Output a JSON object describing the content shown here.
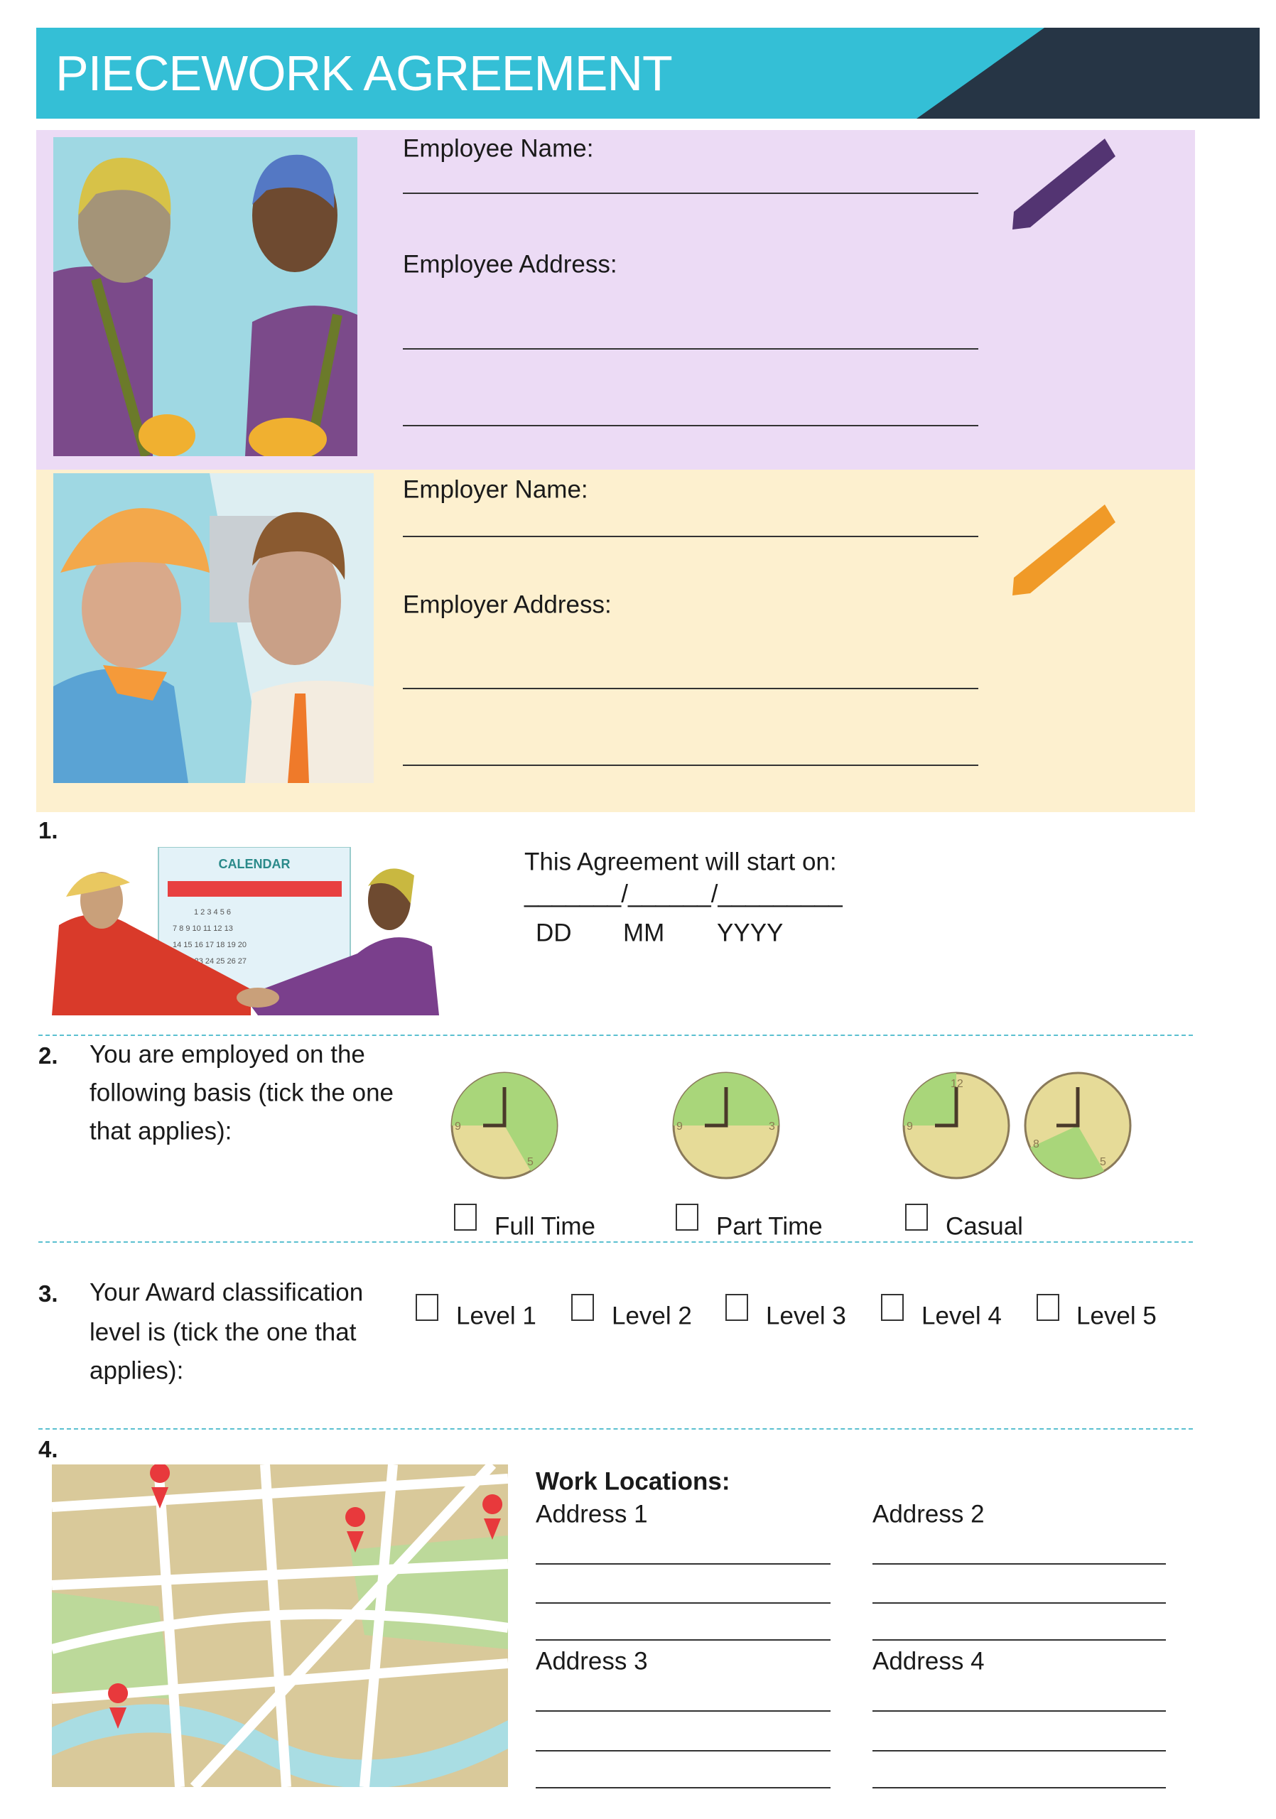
{
  "header": {
    "title": "PIECEWORK AGREEMENT",
    "accent": "#34bfd6",
    "dark": "#263545"
  },
  "employee": {
    "name_label": "Employee Name:",
    "address_label": "Employee Address:",
    "bg": "#ecdbf5",
    "pencil_icon": "pencil-icon",
    "pencil_color": "#533472"
  },
  "employer": {
    "name_label": "Employer Name:",
    "address_label": "Employer Address:",
    "bg": "#fdf0cf",
    "pencil_icon": "pencil-icon",
    "pencil_color": "#f09a28"
  },
  "section1": {
    "number": "1.",
    "calendar_title": "CALENDAR",
    "prompt": "This Agreement will start on:",
    "date_blank": "_______/______/_________",
    "dd": "DD",
    "mm": "MM",
    "yyyy": "YYYY"
  },
  "section2": {
    "number": "2.",
    "text_lines": [
      "You are employed on the",
      "following basis (tick the one",
      "that applies):"
    ],
    "options": [
      {
        "label": "Full Time",
        "checked": false
      },
      {
        "label": "Part  Time",
        "checked": false
      },
      {
        "label": "Casual",
        "checked": false
      }
    ],
    "clock_numbers": {
      "full_time": [
        "9",
        "5"
      ],
      "part_time": [
        "9",
        "3"
      ],
      "casual_a": [
        "12",
        "9"
      ],
      "casual_b": [
        "8",
        "5"
      ]
    }
  },
  "section3": {
    "number": "3.",
    "text_lines": [
      "Your Award classification",
      "level is (tick the one that",
      "applies):"
    ],
    "levels": [
      {
        "label": "Level 1",
        "checked": false
      },
      {
        "label": "Level 2",
        "checked": false
      },
      {
        "label": "Level 3",
        "checked": false
      },
      {
        "label": "Level 4",
        "checked": false
      },
      {
        "label": "Level 5",
        "checked": false
      }
    ]
  },
  "section4": {
    "number": "4.",
    "heading": "Work Locations:",
    "addresses": [
      "Address 1",
      "Address 2",
      "Address 3",
      "Address 4"
    ]
  }
}
